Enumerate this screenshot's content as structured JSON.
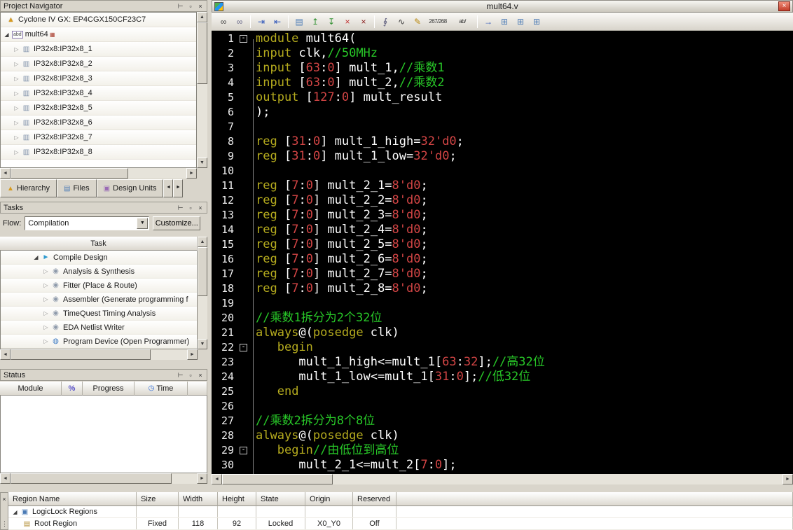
{
  "chrome": {
    "pin_icon": "⊥",
    "float_icon": "▫",
    "close_icon": "×",
    "dropdown_arrow": "▼",
    "arrow_left": "◄",
    "arrow_right": "►",
    "arrow_up": "▲",
    "arrow_down": "▼",
    "grip_dots": "⋮"
  },
  "project_navigator": {
    "title": "Project Navigator",
    "device": "Cyclone IV GX: EP4CGX150CF23C7",
    "module": "mult64",
    "module_badge": "abd",
    "ip_nodes": [
      "IP32x8:IP32x8_1",
      "IP32x8:IP32x8_2",
      "IP32x8:IP32x8_3",
      "IP32x8:IP32x8_4",
      "IP32x8:IP32x8_5",
      "IP32x8:IP32x8_6",
      "IP32x8:IP32x8_7",
      "IP32x8:IP32x8_8"
    ],
    "tabs": [
      {
        "label": "Hierarchy",
        "icon": "hierarchy-icon",
        "glyph": "▲",
        "color": "#d79a1e"
      },
      {
        "label": "Files",
        "icon": "files-icon",
        "glyph": "▤",
        "color": "#4a7ab5"
      },
      {
        "label": "Design Units",
        "icon": "design-units-icon",
        "glyph": "▣",
        "color": "#9a6ab5"
      }
    ]
  },
  "tasks": {
    "title": "Tasks",
    "flow_label": "Flow:",
    "flow_value": "Compilation",
    "customize_label": "Customize...",
    "column_header": "Task",
    "items": [
      {
        "label": "Compile Design",
        "level": 0
      },
      {
        "label": "Analysis & Synthesis",
        "level": 1
      },
      {
        "label": "Fitter (Place & Route)",
        "level": 1
      },
      {
        "label": "Assembler (Generate programming f",
        "level": 1
      },
      {
        "label": "TimeQuest Timing Analysis",
        "level": 1
      },
      {
        "label": "EDA Netlist Writer",
        "level": 1
      },
      {
        "label": "Program Device (Open Programmer)",
        "level": 1
      }
    ]
  },
  "status": {
    "title": "Status",
    "columns": [
      "Module",
      "%",
      "Progress",
      "Time"
    ]
  },
  "editor": {
    "title": "mult64.v",
    "colors": {
      "keyword": "#b5ab1e",
      "plain": "#ffffff",
      "number": "#d34545",
      "comment": "#28c828",
      "background": "#000000"
    },
    "toolbar": [
      {
        "name": "find-icon",
        "glyph": "∞",
        "color": "#404040"
      },
      {
        "name": "find-next-icon",
        "glyph": "∞",
        "color": "#6a6a8a"
      },
      {
        "sep": true
      },
      {
        "name": "increase-indent-icon",
        "glyph": "⇥",
        "color": "#2a52b8"
      },
      {
        "name": "decrease-indent-icon",
        "glyph": "⇤",
        "color": "#2a52b8"
      },
      {
        "sep": true
      },
      {
        "name": "open-file-icon",
        "glyph": "▤",
        "color": "#4a7ab5"
      },
      {
        "name": "insert-file-icon",
        "glyph": "↥",
        "color": "#2f8f2f"
      },
      {
        "name": "append-file-icon",
        "glyph": "↧",
        "color": "#2f8f2f"
      },
      {
        "name": "remove-file-icon",
        "glyph": "×",
        "color": "#c03030"
      },
      {
        "name": "delete-all-icon",
        "glyph": "×",
        "color": "#8a2020"
      },
      {
        "sep": true
      },
      {
        "name": "attach-icon",
        "glyph": "∮",
        "color": "#555577"
      },
      {
        "name": "waveform-icon",
        "glyph": "∿",
        "color": "#333333"
      },
      {
        "name": "edit-pencil-icon",
        "glyph": "✎",
        "color": "#b8860b"
      },
      {
        "name": "line-count-indicator",
        "glyph": "267/268",
        "wide": true,
        "color": "#333333"
      },
      {
        "name": "word-select-icon",
        "glyph": "ab/",
        "wide": true,
        "color": "#333333"
      },
      {
        "sep": true
      },
      {
        "name": "goto-icon",
        "glyph": "→",
        "color": "#2a52b8"
      },
      {
        "name": "window-cascade-icon",
        "glyph": "⊞",
        "color": "#4a7ab5"
      },
      {
        "name": "window-tile-icon",
        "glyph": "⊞",
        "color": "#4a7ab5"
      },
      {
        "name": "new-window-icon",
        "glyph": "⊞",
        "color": "#4a7ab5"
      }
    ],
    "lines": [
      {
        "n": 1,
        "fold": true,
        "seg": [
          [
            "k",
            "module"
          ],
          [
            "p",
            " mult64("
          ]
        ]
      },
      {
        "n": 2,
        "seg": [
          [
            "k",
            "input"
          ],
          [
            "p",
            " clk,"
          ],
          [
            "c",
            "//50MHz"
          ]
        ]
      },
      {
        "n": 3,
        "seg": [
          [
            "k",
            "input"
          ],
          [
            "p",
            " ["
          ],
          [
            "n",
            "63"
          ],
          [
            "p",
            ":"
          ],
          [
            "n",
            "0"
          ],
          [
            "p",
            "] mult_1,"
          ],
          [
            "c",
            "//乘数1"
          ]
        ]
      },
      {
        "n": 4,
        "seg": [
          [
            "k",
            "input"
          ],
          [
            "p",
            " ["
          ],
          [
            "n",
            "63"
          ],
          [
            "p",
            ":"
          ],
          [
            "n",
            "0"
          ],
          [
            "p",
            "] mult_2,"
          ],
          [
            "c",
            "//乘数2"
          ]
        ]
      },
      {
        "n": 5,
        "seg": [
          [
            "k",
            "output"
          ],
          [
            "p",
            " ["
          ],
          [
            "n",
            "127"
          ],
          [
            "p",
            ":"
          ],
          [
            "n",
            "0"
          ],
          [
            "p",
            "] mult_result"
          ]
        ]
      },
      {
        "n": 6,
        "seg": [
          [
            "p",
            ");"
          ]
        ]
      },
      {
        "n": 7,
        "seg": []
      },
      {
        "n": 8,
        "seg": [
          [
            "k",
            "reg"
          ],
          [
            "p",
            " ["
          ],
          [
            "n",
            "31"
          ],
          [
            "p",
            ":"
          ],
          [
            "n",
            "0"
          ],
          [
            "p",
            "] mult_1_high="
          ],
          [
            "n",
            "32'd0"
          ],
          [
            "p",
            ";"
          ]
        ]
      },
      {
        "n": 9,
        "seg": [
          [
            "k",
            "reg"
          ],
          [
            "p",
            " ["
          ],
          [
            "n",
            "31"
          ],
          [
            "p",
            ":"
          ],
          [
            "n",
            "0"
          ],
          [
            "p",
            "] mult_1_low="
          ],
          [
            "n",
            "32'd0"
          ],
          [
            "p",
            ";"
          ]
        ]
      },
      {
        "n": 10,
        "seg": []
      },
      {
        "n": 11,
        "seg": [
          [
            "k",
            "reg"
          ],
          [
            "p",
            " ["
          ],
          [
            "n",
            "7"
          ],
          [
            "p",
            ":"
          ],
          [
            "n",
            "0"
          ],
          [
            "p",
            "] mult_2_1="
          ],
          [
            "n",
            "8'd0"
          ],
          [
            "p",
            ";"
          ]
        ]
      },
      {
        "n": 12,
        "seg": [
          [
            "k",
            "reg"
          ],
          [
            "p",
            " ["
          ],
          [
            "n",
            "7"
          ],
          [
            "p",
            ":"
          ],
          [
            "n",
            "0"
          ],
          [
            "p",
            "] mult_2_2="
          ],
          [
            "n",
            "8'd0"
          ],
          [
            "p",
            ";"
          ]
        ]
      },
      {
        "n": 13,
        "seg": [
          [
            "k",
            "reg"
          ],
          [
            "p",
            " ["
          ],
          [
            "n",
            "7"
          ],
          [
            "p",
            ":"
          ],
          [
            "n",
            "0"
          ],
          [
            "p",
            "] mult_2_3="
          ],
          [
            "n",
            "8'd0"
          ],
          [
            "p",
            ";"
          ]
        ]
      },
      {
        "n": 14,
        "seg": [
          [
            "k",
            "reg"
          ],
          [
            "p",
            " ["
          ],
          [
            "n",
            "7"
          ],
          [
            "p",
            ":"
          ],
          [
            "n",
            "0"
          ],
          [
            "p",
            "] mult_2_4="
          ],
          [
            "n",
            "8'd0"
          ],
          [
            "p",
            ";"
          ]
        ]
      },
      {
        "n": 15,
        "seg": [
          [
            "k",
            "reg"
          ],
          [
            "p",
            " ["
          ],
          [
            "n",
            "7"
          ],
          [
            "p",
            ":"
          ],
          [
            "n",
            "0"
          ],
          [
            "p",
            "] mult_2_5="
          ],
          [
            "n",
            "8'd0"
          ],
          [
            "p",
            ";"
          ]
        ]
      },
      {
        "n": 16,
        "seg": [
          [
            "k",
            "reg"
          ],
          [
            "p",
            " ["
          ],
          [
            "n",
            "7"
          ],
          [
            "p",
            ":"
          ],
          [
            "n",
            "0"
          ],
          [
            "p",
            "] mult_2_6="
          ],
          [
            "n",
            "8'd0"
          ],
          [
            "p",
            ";"
          ]
        ]
      },
      {
        "n": 17,
        "seg": [
          [
            "k",
            "reg"
          ],
          [
            "p",
            " ["
          ],
          [
            "n",
            "7"
          ],
          [
            "p",
            ":"
          ],
          [
            "n",
            "0"
          ],
          [
            "p",
            "] mult_2_7="
          ],
          [
            "n",
            "8'd0"
          ],
          [
            "p",
            ";"
          ]
        ]
      },
      {
        "n": 18,
        "seg": [
          [
            "k",
            "reg"
          ],
          [
            "p",
            " ["
          ],
          [
            "n",
            "7"
          ],
          [
            "p",
            ":"
          ],
          [
            "n",
            "0"
          ],
          [
            "p",
            "] mult_2_8="
          ],
          [
            "n",
            "8'd0"
          ],
          [
            "p",
            ";"
          ]
        ]
      },
      {
        "n": 19,
        "seg": []
      },
      {
        "n": 20,
        "seg": [
          [
            "c",
            "//乘数1拆分为2个32位"
          ]
        ]
      },
      {
        "n": 21,
        "seg": [
          [
            "k",
            "always"
          ],
          [
            "p",
            "@("
          ],
          [
            "k",
            "posedge"
          ],
          [
            "p",
            " clk)"
          ]
        ]
      },
      {
        "n": 22,
        "fold": true,
        "seg": [
          [
            "p",
            "   "
          ],
          [
            "k",
            "begin"
          ]
        ]
      },
      {
        "n": 23,
        "seg": [
          [
            "p",
            "      mult_1_high<=mult_1["
          ],
          [
            "n",
            "63"
          ],
          [
            "p",
            ":"
          ],
          [
            "n",
            "32"
          ],
          [
            "p",
            "];"
          ],
          [
            "c",
            "//高32位"
          ]
        ]
      },
      {
        "n": 24,
        "seg": [
          [
            "p",
            "      mult_1_low<=mult_1["
          ],
          [
            "n",
            "31"
          ],
          [
            "p",
            ":"
          ],
          [
            "n",
            "0"
          ],
          [
            "p",
            "];"
          ],
          [
            "c",
            "//低32位"
          ]
        ]
      },
      {
        "n": 25,
        "seg": [
          [
            "p",
            "   "
          ],
          [
            "k",
            "end"
          ]
        ]
      },
      {
        "n": 26,
        "seg": []
      },
      {
        "n": 27,
        "seg": [
          [
            "c",
            "//乘数2拆分为8个8位"
          ]
        ]
      },
      {
        "n": 28,
        "seg": [
          [
            "k",
            "always"
          ],
          [
            "p",
            "@("
          ],
          [
            "k",
            "posedge"
          ],
          [
            "p",
            " clk)"
          ]
        ]
      },
      {
        "n": 29,
        "fold": true,
        "seg": [
          [
            "p",
            "   "
          ],
          [
            "k",
            "begin"
          ],
          [
            "c",
            "//由低位到高位"
          ]
        ]
      },
      {
        "n": 30,
        "seg": [
          [
            "p",
            "      mult_2_1<=mult_2["
          ],
          [
            "n",
            "7"
          ],
          [
            "p",
            ":"
          ],
          [
            "n",
            "0"
          ],
          [
            "p",
            "];"
          ]
        ]
      }
    ]
  },
  "regions": {
    "columns": [
      "Region Name",
      "Size",
      "Width",
      "Height",
      "State",
      "Origin",
      "Reserved"
    ],
    "rows": [
      {
        "name": "LogicLock Regions",
        "level": 0,
        "cells": [
          "",
          "",
          "",
          "",
          "",
          ""
        ]
      },
      {
        "name": "Root Region",
        "level": 1,
        "cells": [
          "Fixed",
          "118",
          "92",
          "Locked",
          "X0_Y0",
          "Off"
        ]
      }
    ]
  }
}
